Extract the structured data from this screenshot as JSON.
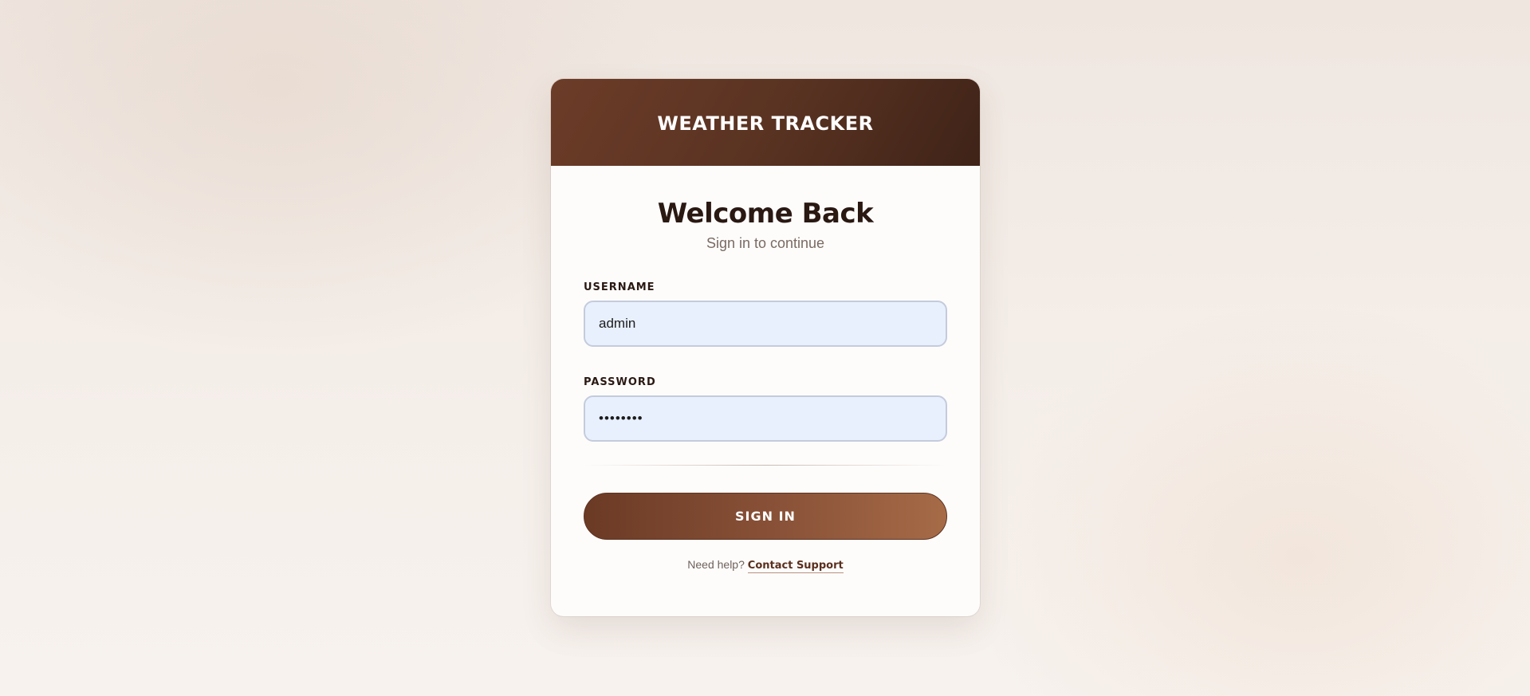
{
  "header": {
    "app_title": "WEATHER TRACKER"
  },
  "login": {
    "heading": "Welcome Back",
    "subtitle": "Sign in to continue",
    "username": {
      "label": "USERNAME",
      "value": "admin"
    },
    "password": {
      "label": "PASSWORD",
      "value": "••••••••"
    },
    "submit_label": "SIGN IN",
    "help_text": "Need help?",
    "help_link_label": "Contact Support"
  },
  "colors": {
    "header_gradient_start": "#6c3c28",
    "header_gradient_end": "#3f2318",
    "button_gradient_start": "#6b3a25",
    "button_gradient_end": "#a66b47",
    "input_background": "#e8f0fe",
    "heading_text": "#2a1812"
  }
}
